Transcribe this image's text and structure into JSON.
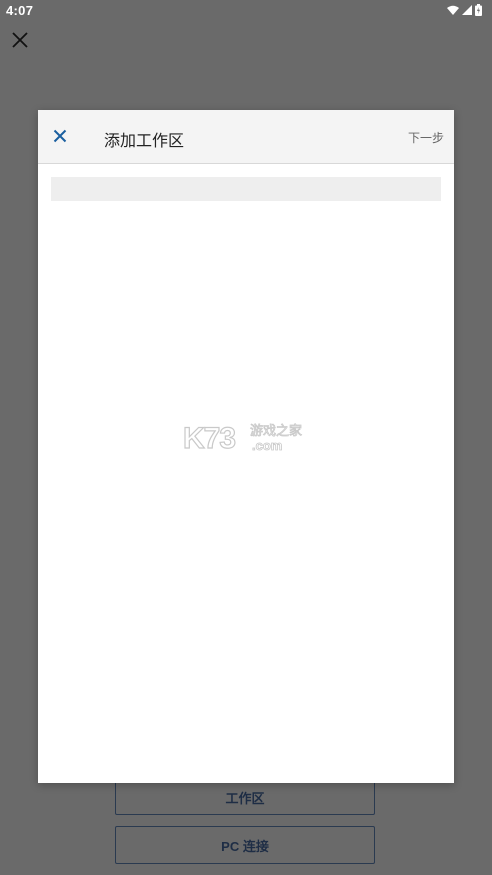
{
  "status_bar": {
    "time": "4:07",
    "icons": [
      "wifi-icon",
      "signal-icon",
      "battery-icon"
    ]
  },
  "background": {
    "close_icon": "close-icon",
    "workspace_button": "工作区",
    "pc_connect_button": "PC 连接"
  },
  "dialog": {
    "title": "添加工作区",
    "next_label": "下一步",
    "close_icon": "close-icon",
    "accent_color": "#1a5fa0"
  },
  "watermark": {
    "logo_text": "K73",
    "site_text": "游戏之家",
    "domain_text": ".com"
  }
}
